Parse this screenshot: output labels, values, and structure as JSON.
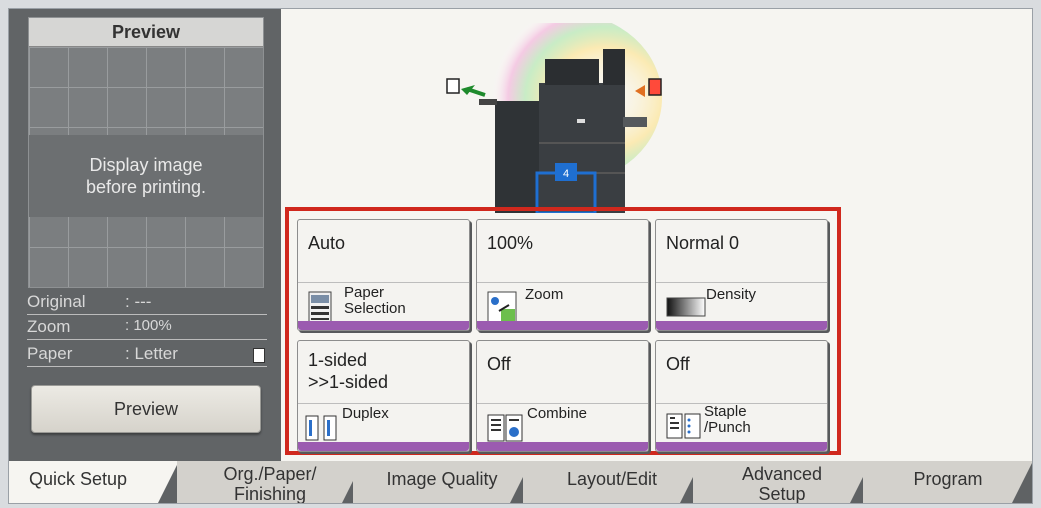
{
  "left_panel": {
    "preview_title": "Preview",
    "preview_message_line1": "Display image",
    "preview_message_line2": "before printing.",
    "original_label": "Original",
    "original_value": ": ---",
    "zoom_label": "Zoom",
    "zoom_value": ": 100%",
    "paper_label": "Paper",
    "paper_value": ": Letter",
    "preview_button": "Preview"
  },
  "keys": {
    "paper": {
      "value": "Auto",
      "label1": "Paper",
      "label2": "Selection"
    },
    "zoom": {
      "value": "100%",
      "label1": "Zoom"
    },
    "density": {
      "value": "Normal 0",
      "label1": "Density"
    },
    "duplex": {
      "value1": "1-sided",
      "value2": ">>1-sided",
      "label1": "Duplex"
    },
    "combine": {
      "value": "Off",
      "label1": "Combine"
    },
    "staple": {
      "value": "Off",
      "label1": "Staple",
      "label2": "/Punch"
    }
  },
  "machine": {
    "tray_number": "4"
  },
  "tabs": [
    {
      "line1": "Quick Setup",
      "line2": ""
    },
    {
      "line1": "Org./Paper/",
      "line2": "Finishing"
    },
    {
      "line1": "Image Quality",
      "line2": ""
    },
    {
      "line1": "Layout/Edit",
      "line2": ""
    },
    {
      "line1": "Advanced",
      "line2": "Setup"
    },
    {
      "line1": "Program",
      "line2": ""
    }
  ],
  "colors": {
    "highlight_frame": "#d0281d",
    "key_accent": "#9b5bb0"
  }
}
